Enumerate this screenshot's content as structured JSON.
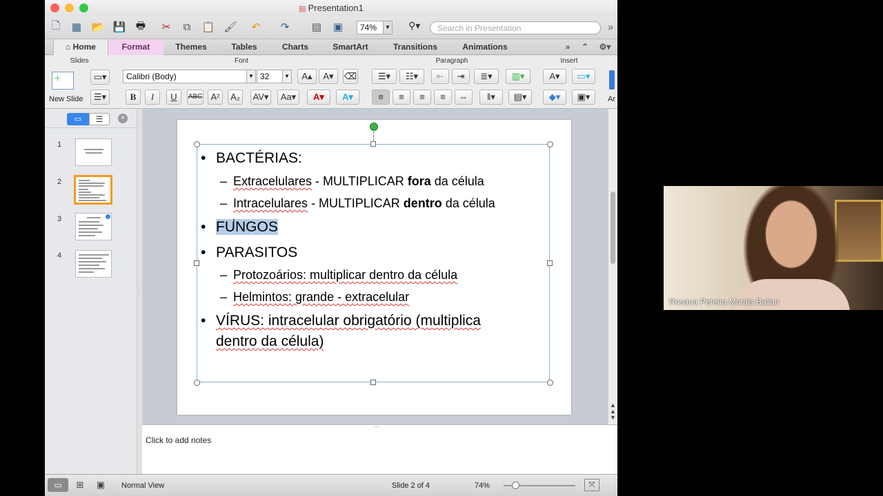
{
  "window": {
    "title": "Presentation1"
  },
  "toolbar": {
    "zoom": "74%",
    "search_placeholder": "Search in Presentation"
  },
  "tabs": [
    "Home",
    "Format",
    "Themes",
    "Tables",
    "Charts",
    "SmartArt",
    "Transitions",
    "Animations"
  ],
  "ribbon": {
    "groups": {
      "slides": "Slides",
      "font": "Font",
      "paragraph": "Paragraph",
      "insert": "Insert"
    },
    "new_slide": "New Slide",
    "font_name": "Calibri (Body)",
    "font_size": "32",
    "extra_label": "Ar"
  },
  "thumbnails": [
    "1",
    "2",
    "3",
    "4"
  ],
  "slide": {
    "b1": "BACTÉRIAS:",
    "b1a_pre": "Extracelulares",
    "b1a_mid": " - MULTIPLICAR ",
    "b1a_bold": "fora",
    "b1a_post": " da célula",
    "b1b_pre": "Intracelulares",
    "b1b_mid": " - MULTIPLICAR ",
    "b1b_bold": "dentro",
    "b1b_post": " da célula",
    "b2": "FUNGOS",
    "b3": "PARASITOS",
    "b3a": "Protozoários: multiplicar dentro da célula",
    "b3b": "Helmintos: grande - extracelular",
    "b4_line1": "VÍRUS: intracelular obrigatório (multiplica",
    "b4_line2": "dentro da célula)",
    "bullet": "•",
    "dash": "–"
  },
  "notes": {
    "placeholder": "Click to add notes"
  },
  "status": {
    "view": "Normal View",
    "slide": "Slide 2 of 4",
    "zoom": "74%"
  },
  "video": {
    "participant": "Rosana Pereira Morais Balian"
  },
  "colors": {
    "format_tab": "#f3d3ef",
    "selected_thumb": "#f59a23",
    "accent": "#3a5d8a"
  }
}
